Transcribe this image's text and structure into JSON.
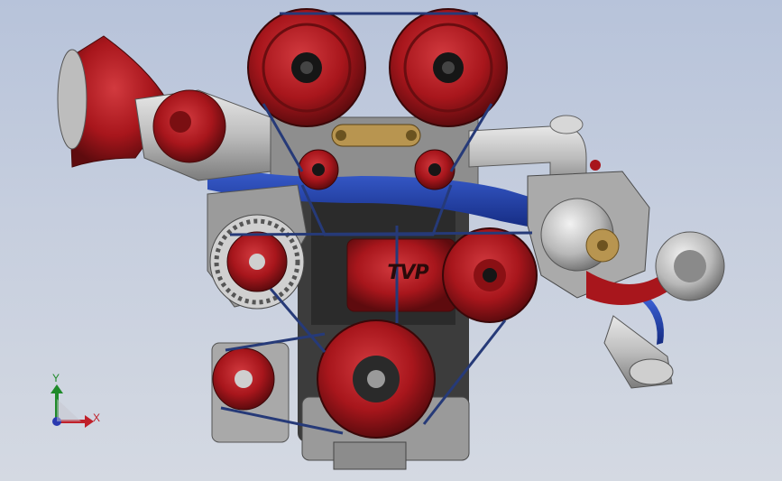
{
  "viewport": {
    "background_top": "#b7c3da",
    "background_bottom": "#d4d9e2"
  },
  "model": {
    "logo_text": "TVP",
    "colors": {
      "red": "#a8161c",
      "red_dark": "#6a0d10",
      "metal": "#bfbfbf",
      "metal_dark": "#6e6e6e",
      "blue": "#1c3fb0",
      "belt": "#263a78",
      "block": "#3c3c3c",
      "gold": "#b89550"
    }
  },
  "triad": {
    "x_label": "X",
    "y_label": "Y",
    "x_color": "#c0202a",
    "y_color": "#1f8a2a",
    "z_color": "#2a3ab0"
  }
}
